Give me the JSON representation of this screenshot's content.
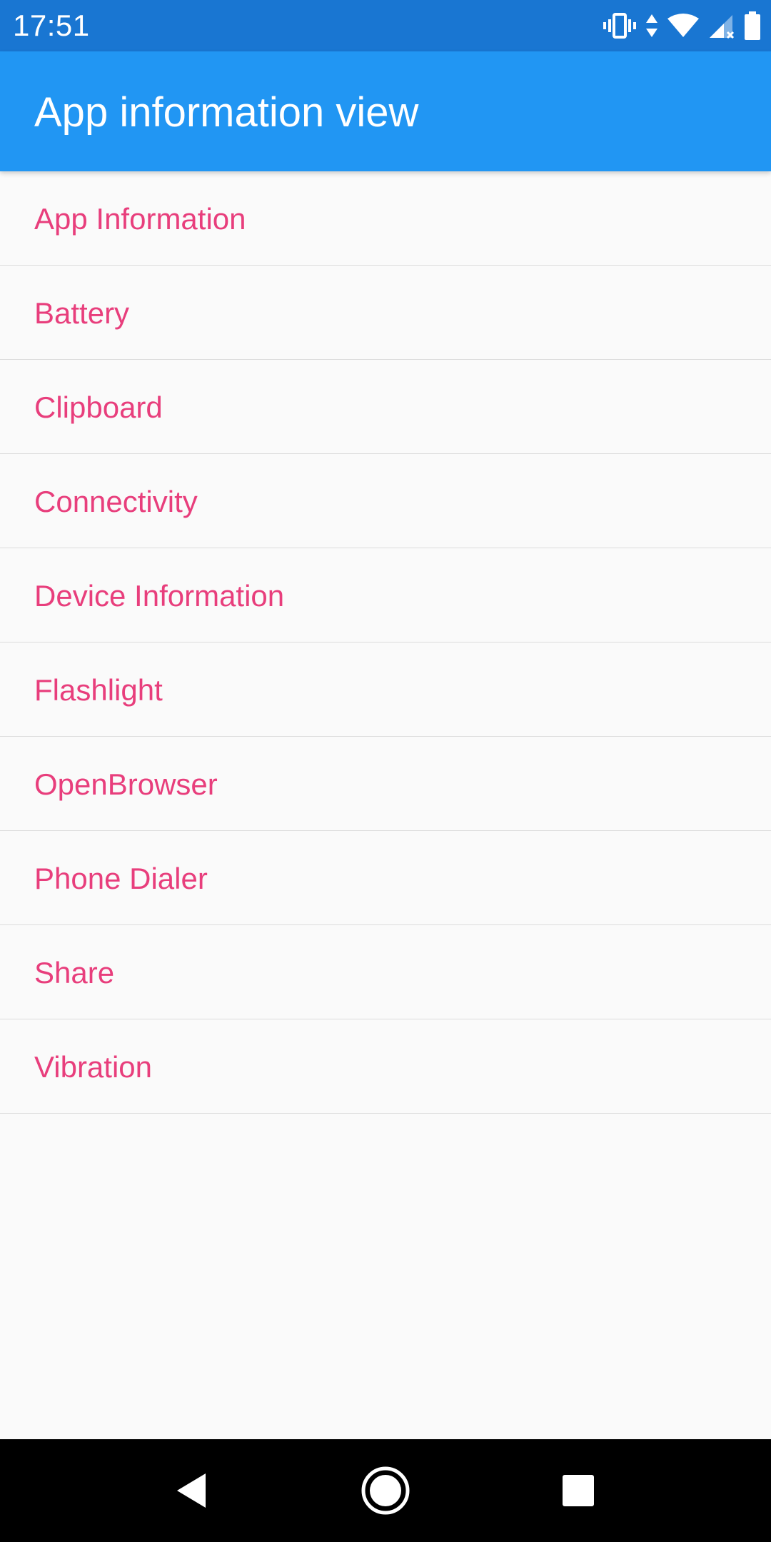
{
  "status_bar": {
    "time": "17:51",
    "icons": [
      "vibrate-icon",
      "data-arrows-icon",
      "wifi-icon",
      "cell-signal-icon",
      "battery-icon"
    ]
  },
  "app_bar": {
    "title": "App information view"
  },
  "list": {
    "items": [
      {
        "label": "App Information"
      },
      {
        "label": "Battery"
      },
      {
        "label": "Clipboard"
      },
      {
        "label": "Connectivity"
      },
      {
        "label": "Device Information"
      },
      {
        "label": "Flashlight"
      },
      {
        "label": "OpenBrowser"
      },
      {
        "label": "Phone Dialer"
      },
      {
        "label": "Share"
      },
      {
        "label": "Vibration"
      }
    ]
  },
  "nav_bar": {
    "buttons": [
      "back-icon",
      "home-icon",
      "recents-icon"
    ]
  },
  "colors": {
    "status_bar": "#1976d2",
    "app_bar": "#2196f3",
    "list_text": "#e83e7c",
    "background": "#fafafa",
    "divider": "#dcdcdc",
    "nav_bar": "#000000"
  }
}
